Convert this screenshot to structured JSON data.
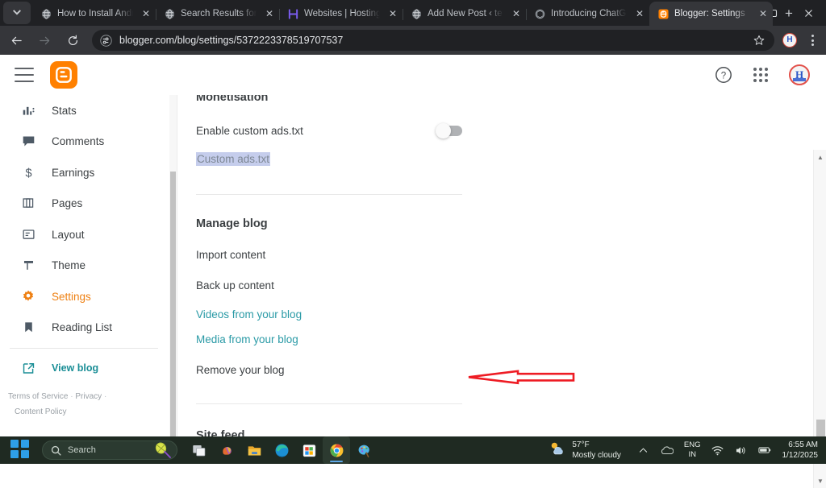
{
  "browser": {
    "tabs": [
      {
        "title": "How to Install Andr",
        "favicon": "globe-icon",
        "active": false
      },
      {
        "title": "Search Results for",
        "favicon": "globe-icon",
        "active": false
      },
      {
        "title": "Websites | Hosting",
        "favicon": "hostinger-icon",
        "active": false
      },
      {
        "title": "Add New Post ‹ te",
        "favicon": "globe-icon",
        "active": false
      },
      {
        "title": "Introducing ChatG",
        "favicon": "openai-icon",
        "active": false
      },
      {
        "title": "Blogger: Settings",
        "favicon": "blogger-icon",
        "active": true
      }
    ],
    "new_tab_label": "+",
    "close_label": "✕",
    "window_controls": {
      "minimize": "minimize-icon",
      "maximize": "maximize-icon",
      "close": "close-icon"
    },
    "omnibox": {
      "url": "blogger.com/blog/settings/5372223378519707537",
      "site_icon": "tune-icon",
      "bookmark_icon": "star-icon"
    },
    "profile_initial": "H",
    "menu_icon": "three-dot-menu-icon"
  },
  "blogger_header": {
    "menu_icon": "hamburger-icon",
    "logo": "blogger-logo-icon",
    "help_icon": "help-circle-icon",
    "apps_icon": "google-apps-grid-icon",
    "avatar_initial": "H"
  },
  "sidebar": {
    "items": [
      {
        "label": "Stats",
        "icon": "bar-chart-icon",
        "active": false
      },
      {
        "label": "Comments",
        "icon": "comment-icon",
        "active": false
      },
      {
        "label": "Earnings",
        "icon": "dollar-icon",
        "active": false
      },
      {
        "label": "Pages",
        "icon": "pages-icon",
        "active": false
      },
      {
        "label": "Layout",
        "icon": "layout-icon",
        "active": false
      },
      {
        "label": "Theme",
        "icon": "theme-brush-icon",
        "active": false
      },
      {
        "label": "Settings",
        "icon": "gear-icon",
        "active": true
      },
      {
        "label": "Reading List",
        "icon": "bookmark-icon",
        "active": false
      }
    ],
    "view_blog": {
      "label": "View blog",
      "icon": "external-link-icon"
    },
    "legal": {
      "terms": "Terms of Service",
      "separator": "·",
      "privacy": "Privacy",
      "content_policy": "Content Policy"
    }
  },
  "main": {
    "monetisation_heading": "Monetisation",
    "enable_custom_ads": {
      "label": "Enable custom ads.txt",
      "toggle_on": false
    },
    "custom_ads_txt": {
      "label": "Custom ads.txt",
      "selected": true
    },
    "manage_blog_heading": "Manage blog",
    "manage_links": [
      {
        "label": "Import content",
        "style": "plain"
      },
      {
        "label": "Back up content",
        "style": "plain"
      },
      {
        "label": "Videos from your blog",
        "style": "teal"
      },
      {
        "label": "Media from your blog",
        "style": "teal"
      },
      {
        "label": "Remove your blog",
        "style": "plain"
      }
    ],
    "site_feed_heading": "Site feed",
    "annotation": {
      "shape": "red-outlined-left-arrow",
      "color": "#ee1c24",
      "points_to": "Back up content"
    }
  },
  "taskbar": {
    "start_icon": "windows-start-icon",
    "search": {
      "placeholder": "Search",
      "icon": "search-icon",
      "decoration": "tennis-racket-icon"
    },
    "apps": [
      {
        "name": "task-view-icon",
        "active": false
      },
      {
        "name": "copilot-icon",
        "active": false
      },
      {
        "name": "file-explorer-icon",
        "active": false
      },
      {
        "name": "edge-icon",
        "active": false
      },
      {
        "name": "microsoft-store-icon",
        "active": false
      },
      {
        "name": "chrome-icon",
        "active": true
      },
      {
        "name": "paint-icon",
        "active": false
      }
    ],
    "weather": {
      "temperature": "57°F",
      "condition": "Mostly cloudy",
      "icon": "partly-cloudy-icon"
    },
    "tray": {
      "chevron": "show-hidden-icons-icon",
      "cloud": "onedrive-icon",
      "language_primary": "ENG",
      "language_secondary": "IN",
      "wifi": "wifi-icon",
      "volume": "speaker-icon",
      "battery": "battery-icon"
    },
    "clock": {
      "time": "6:55 AM",
      "date": "1/12/2025"
    }
  }
}
